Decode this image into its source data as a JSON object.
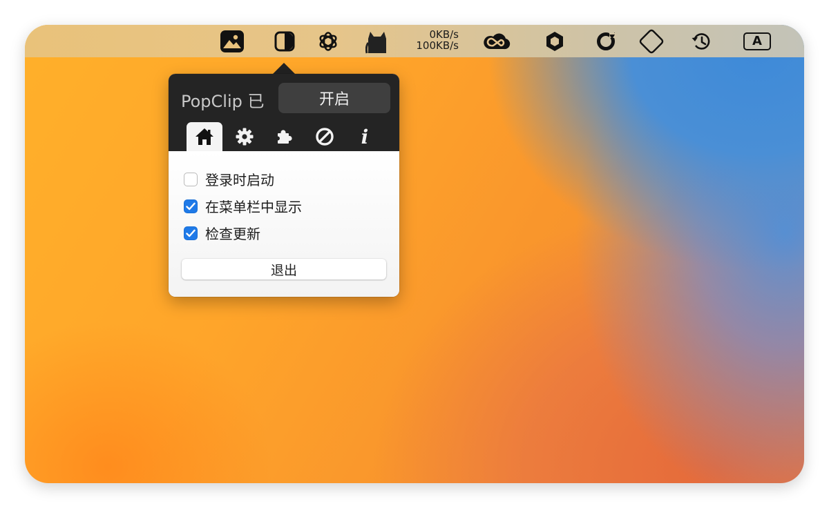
{
  "menubar": {
    "items": [
      {
        "name": "photo-app-icon"
      },
      {
        "name": "contrast-icon"
      },
      {
        "name": "openai-icon"
      },
      {
        "name": "cat-icon"
      },
      {
        "name": "creative-cloud-icon"
      },
      {
        "name": "hexagon-icon"
      },
      {
        "name": "sync-ring-icon"
      },
      {
        "name": "diamond-icon"
      },
      {
        "name": "time-machine-icon"
      },
      {
        "name": "input-source-icon",
        "label": "A"
      }
    ],
    "network": {
      "up": "0KB/s",
      "down": "100KB/s"
    }
  },
  "popover": {
    "title": "PopClip 已",
    "toggle_label": "开启",
    "tabs": [
      {
        "name": "home",
        "glyph": "home-icon",
        "active": true
      },
      {
        "name": "settings",
        "glyph": "gear-icon",
        "active": false
      },
      {
        "name": "extensions",
        "glyph": "puzzle-icon",
        "active": false
      },
      {
        "name": "excluded-apps",
        "glyph": "prohibit-icon",
        "active": false
      },
      {
        "name": "about",
        "glyph": "info-icon",
        "label": "i",
        "active": false
      }
    ],
    "options": [
      {
        "label": "登录时启动",
        "checked": false
      },
      {
        "label": "在菜单栏中显示",
        "checked": true
      },
      {
        "label": "检查更新",
        "checked": true
      }
    ],
    "quit_label": "退出"
  },
  "colors": {
    "accent": "#1f7ae8",
    "popover_header": "#242424",
    "wallpaper_orange": "#ffa52a",
    "wallpaper_blue": "#3e8ad8"
  }
}
